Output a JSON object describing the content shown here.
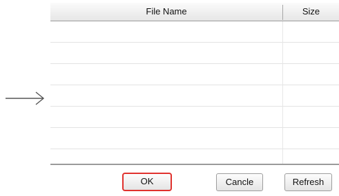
{
  "table": {
    "columns": [
      {
        "label": "File Name"
      },
      {
        "label": "Size"
      }
    ],
    "rows": [
      {
        "file_name": "",
        "size": ""
      },
      {
        "file_name": "",
        "size": ""
      },
      {
        "file_name": "",
        "size": ""
      },
      {
        "file_name": "",
        "size": ""
      },
      {
        "file_name": "",
        "size": ""
      },
      {
        "file_name": "",
        "size": ""
      },
      {
        "file_name": "",
        "size": ""
      }
    ]
  },
  "buttons": {
    "ok_label": "OK",
    "cancel_label": "Cancle",
    "refresh_label": "Refresh"
  },
  "colors": {
    "highlight_border": "#e0312d",
    "grid_line": "#e3e3e3",
    "header_border": "#9a9a9a"
  },
  "icons": {
    "pointer": "right-arrow-icon"
  }
}
